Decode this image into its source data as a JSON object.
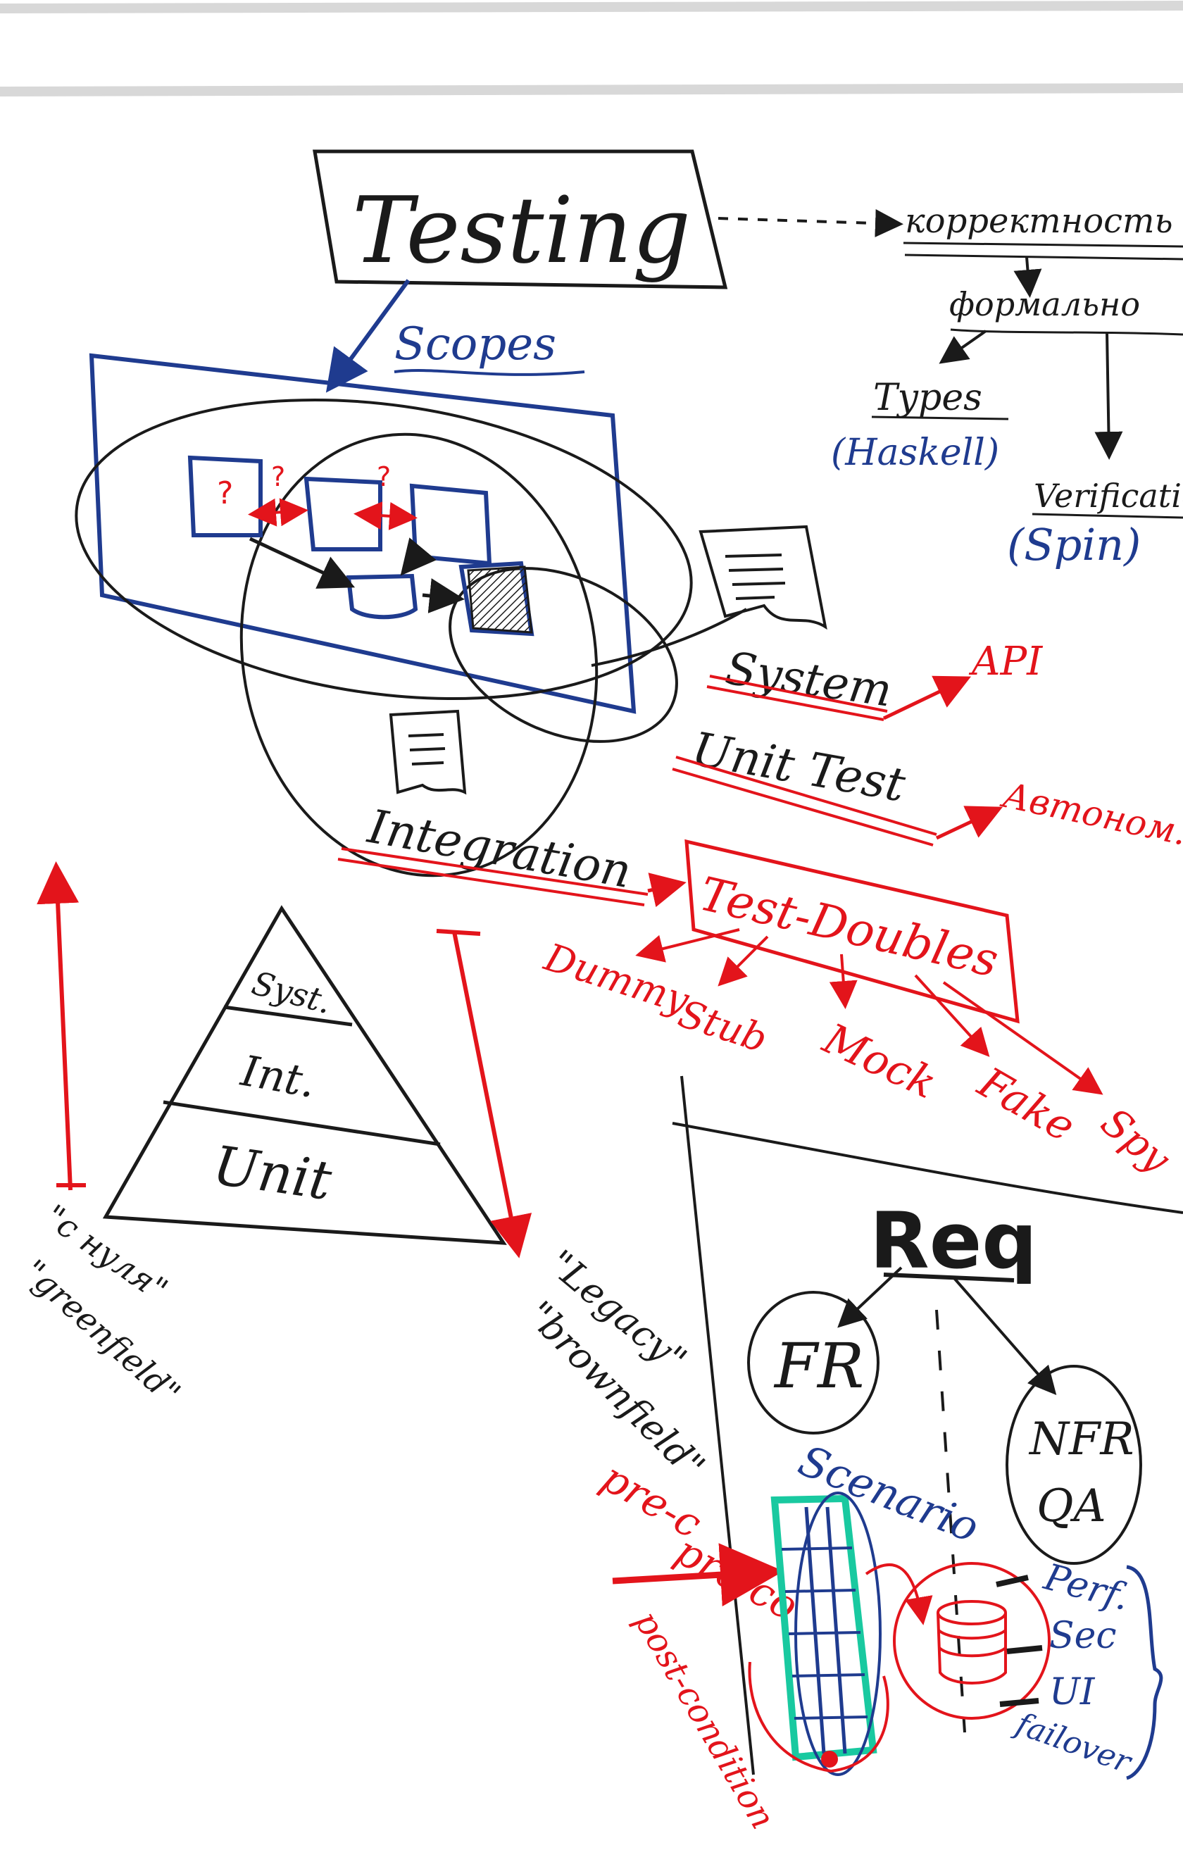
{
  "colors": {
    "black": "#1a1a1a",
    "blue": "#1f3b8f",
    "red": "#e3141b",
    "teal": "#19c9a0",
    "paper": "#ffffff"
  },
  "labels": {
    "testing": "Testing",
    "korrektnost": "корректность",
    "formalnost": "формально",
    "types": "Types",
    "haskell": "(Haskell)",
    "verification": "Verificatio",
    "spin": "(Spin)",
    "scopes": "Scopes",
    "q1": "?",
    "q2": "?",
    "q3": "?",
    "system": "System",
    "api": "API",
    "unit_test": "Unit Test",
    "avtonom": "Автоном.",
    "integration": "Integration",
    "test_doubles": "Test-Doubles",
    "dummy": "Dummy",
    "stub": "Stub",
    "mock": "Mock",
    "fake": "Fake",
    "spy": "Spy",
    "pyramid_syst": "Syst.",
    "pyramid_int": "Int.",
    "pyramid_unit": "Unit",
    "s_nulya": "\"с нуля\"",
    "greenfield": "\"greenfield\"",
    "legacy": "\"Legacy\"",
    "brownfield": "\"brownfield\"",
    "req": "Req",
    "fr": "FR",
    "nfr": "NFR",
    "qa": "QA",
    "scenario": "Scenario",
    "pre_c": "pre-c",
    "pre_co": "pre-co",
    "post_condition": "post-condition",
    "perf": "Perf.",
    "sec": "Sec",
    "ut": "UI",
    "failover": "failover"
  }
}
